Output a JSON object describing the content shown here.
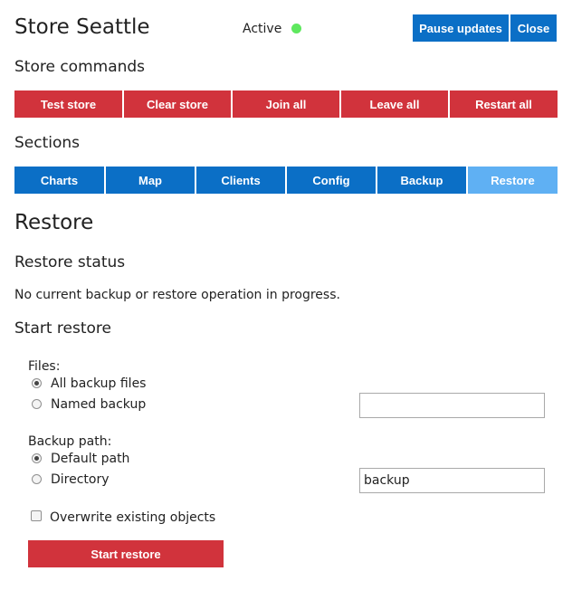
{
  "header": {
    "title": "Store Seattle",
    "status_label": "Active",
    "status_color": "#5ee85e",
    "pause_label": "Pause updates",
    "close_label": "Close"
  },
  "store_commands": {
    "heading": "Store commands",
    "buttons": [
      "Test store",
      "Clear store",
      "Join all",
      "Leave all",
      "Restart all"
    ]
  },
  "sections": {
    "heading": "Sections",
    "tabs": [
      "Charts",
      "Map",
      "Clients",
      "Config",
      "Backup",
      "Restore"
    ],
    "active_tab": "Restore"
  },
  "page": {
    "title": "Restore",
    "status_heading": "Restore status",
    "status_text": "No current backup or restore operation in progress.",
    "start_heading": "Start restore"
  },
  "form": {
    "files_label": "Files:",
    "files_options": [
      "All backup files",
      "Named backup"
    ],
    "named_backup_value": "",
    "path_label": "Backup path:",
    "path_options": [
      "Default path",
      "Directory"
    ],
    "directory_value": "backup",
    "overwrite_label": "Overwrite existing objects",
    "submit_label": "Start restore"
  },
  "colors": {
    "blue": "#0b6fc6",
    "red": "#d1333c",
    "active_tab": "#5fb0f3"
  }
}
